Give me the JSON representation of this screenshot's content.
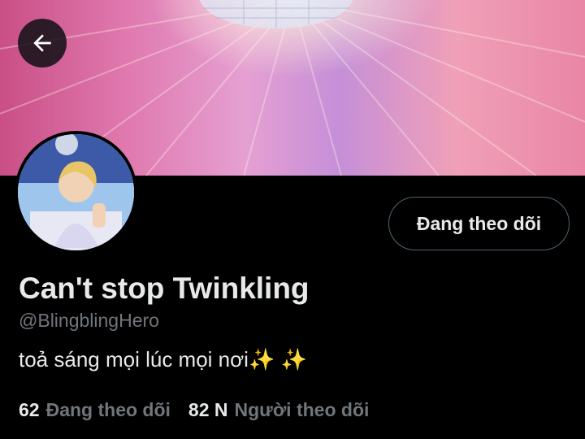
{
  "header": {
    "back_icon": "arrow-left-icon"
  },
  "profile": {
    "display_name": "Can't stop Twinkling",
    "handle": "@BlingblingHero",
    "bio": "toả sáng mọi lúc mọi nơi✨ ✨",
    "follow_button_label": "Đang theo dõi"
  },
  "stats": {
    "following_count": "62",
    "following_label": "Đang theo dõi",
    "followers_count": "82 N",
    "followers_label": "Người theo dõi"
  },
  "colors": {
    "background": "#000000",
    "primary_text": "#e7e9ea",
    "secondary_text": "#71767b",
    "button_border": "#536471"
  }
}
